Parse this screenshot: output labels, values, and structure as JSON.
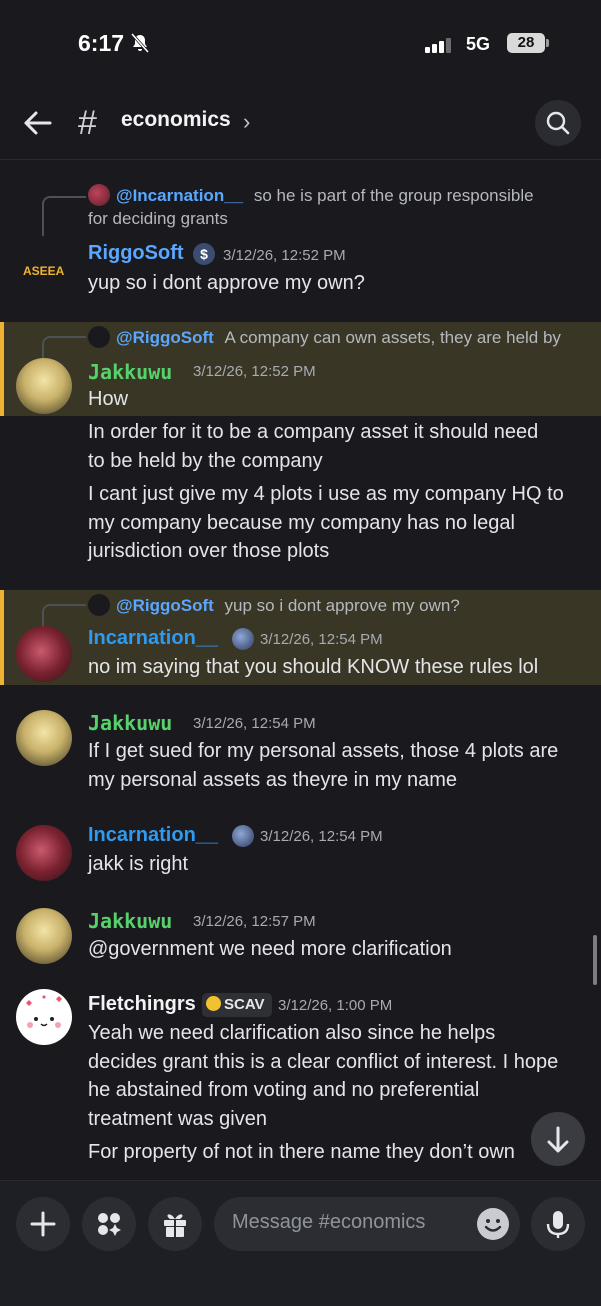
{
  "status": {
    "time": "6:17",
    "network": "5G",
    "battery": "28"
  },
  "header": {
    "channel": "economics"
  },
  "messages": [
    {
      "reply_to": "@Incarnation__",
      "reply_text": "so he is part of the group responsible",
      "reply_text2": "for deciding grants",
      "author": "RiggoSoft",
      "avatar_text": "ASEEA",
      "timestamp": "3/12/26, 12:52 PM",
      "lines": [
        "yup so i dont approve my own?"
      ]
    },
    {
      "reply_to": "@RiggoSoft",
      "reply_text": "A company can own assets, they are held by",
      "author": "Jakkuwu",
      "timestamp": "3/12/26, 12:52 PM",
      "lines": [
        "How",
        "In order for it to  be a company asset it should need",
        "to be held by the company",
        "I cant just give my 4 plots i use as my company HQ to",
        "my company because my company has no legal",
        "jurisdiction over those plots"
      ]
    },
    {
      "reply_to": "@RiggoSoft",
      "reply_text": "yup so i dont approve my own?",
      "author": "Incarnation__",
      "timestamp": "3/12/26, 12:54 PM",
      "lines": [
        "no im saying that you should KNOW these rules lol"
      ]
    },
    {
      "author": "Jakkuwu",
      "timestamp": "3/12/26, 12:54 PM",
      "lines": [
        "If I get sued for my personal assets, those 4 plots are",
        "my personal assets as theyre in my name"
      ]
    },
    {
      "author": "Incarnation__",
      "timestamp": "3/12/26, 12:54 PM",
      "lines": [
        "jakk is right"
      ]
    },
    {
      "author": "Jakkuwu",
      "timestamp": "3/12/26, 12:57 PM",
      "lines": [
        "@government we need more clarification"
      ]
    },
    {
      "author": "Fletchingrs",
      "tag": "SCAV",
      "timestamp": "3/12/26, 1:00 PM",
      "lines": [
        "Yeah we need clarification also since he helps",
        "decides grant this is a clear conflict of interest. I hope",
        "he abstained from voting and no preferential",
        "treatment was given",
        "For property of not in there name they don’t own"
      ]
    }
  ],
  "composer": {
    "placeholder": "Message #economics"
  },
  "colors": {
    "background": "#1a1a1e",
    "highlight_bg": "#3a3625",
    "highlight_bar": "#f0b232",
    "link": "#5aa7ff",
    "riggosoft": "#5aa7ff",
    "jakkuwu": "#57d16b",
    "incarnation": "#2e9bf0"
  }
}
